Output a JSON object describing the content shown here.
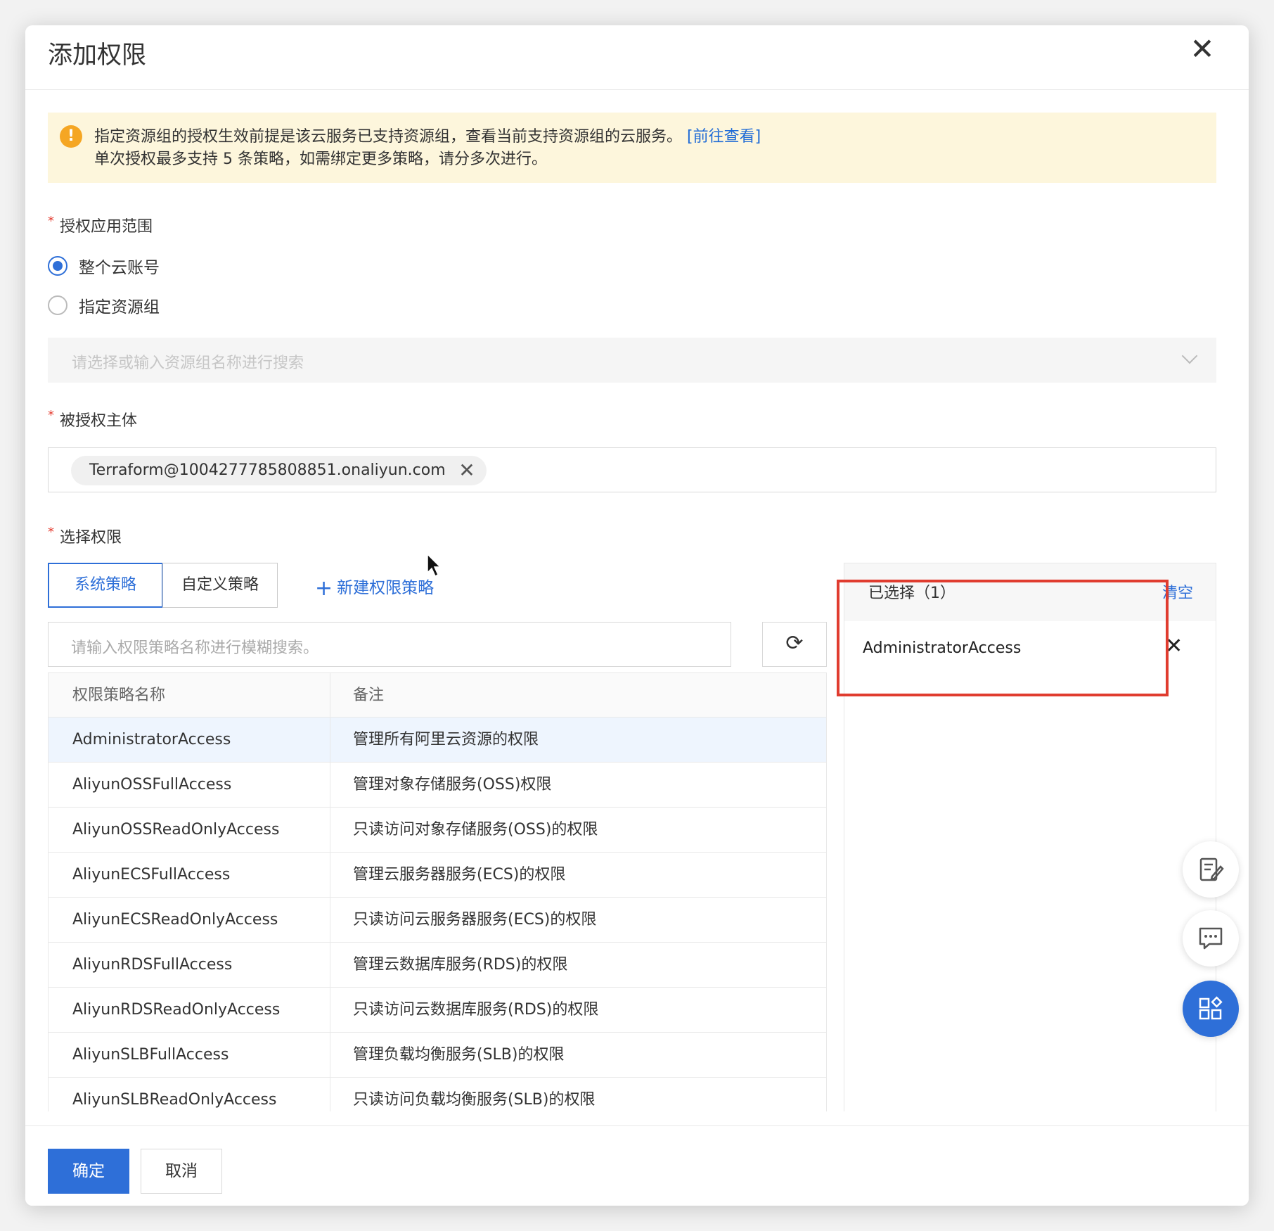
{
  "dialog": {
    "title": "添加权限",
    "close_icon": "close-icon"
  },
  "notice": {
    "icon": "warning-icon",
    "line1": "指定资源组的授权生效前提是该云服务已支持资源组，查看当前支持资源组的云服务。",
    "link": "[前往查看]",
    "line2": "单次授权最多支持 5 条策略，如需绑定更多策略，请分多次进行。"
  },
  "scope": {
    "label": "授权应用范围",
    "options": [
      {
        "label": "整个云账号",
        "selected": true
      },
      {
        "label": "指定资源组",
        "selected": false
      }
    ],
    "resource_group_placeholder": "请选择或输入资源组名称进行搜索"
  },
  "principal": {
    "label": "被授权主体",
    "tag": "Terraform@1004277785808851.onaliyun.com"
  },
  "permissions": {
    "label": "选择权限",
    "tabs": [
      {
        "label": "系统策略",
        "active": true
      },
      {
        "label": "自定义策略",
        "active": false
      }
    ],
    "new_policy": "新建权限策略",
    "search_placeholder": "请输入权限策略名称进行模糊搜索。",
    "table": {
      "headers": [
        "权限策略名称",
        "备注"
      ],
      "rows": [
        [
          "AdministratorAccess",
          "管理所有阿里云资源的权限"
        ],
        [
          "AliyunOSSFullAccess",
          "管理对象存储服务(OSS)权限"
        ],
        [
          "AliyunOSSReadOnlyAccess",
          "只读访问对象存储服务(OSS)的权限"
        ],
        [
          "AliyunECSFullAccess",
          "管理云服务器服务(ECS)的权限"
        ],
        [
          "AliyunECSReadOnlyAccess",
          "只读访问云服务器服务(ECS)的权限"
        ],
        [
          "AliyunRDSFullAccess",
          "管理云数据库服务(RDS)的权限"
        ],
        [
          "AliyunRDSReadOnlyAccess",
          "只读访问云数据库服务(RDS)的权限"
        ],
        [
          "AliyunSLBFullAccess",
          "管理负载均衡服务(SLB)的权限"
        ],
        [
          "AliyunSLBReadOnlyAccess",
          "只读访问负载均衡服务(SLB)的权限"
        ]
      ]
    },
    "selected": {
      "title": "已选择（1）",
      "clear": "清空",
      "items": [
        "AdministratorAccess"
      ]
    }
  },
  "footer": {
    "ok": "确定",
    "cancel": "取消"
  },
  "colors": {
    "primary": "#2e6fd8",
    "highlight_box": "#e03c2f",
    "notice_bg": "#fdf6dc"
  }
}
